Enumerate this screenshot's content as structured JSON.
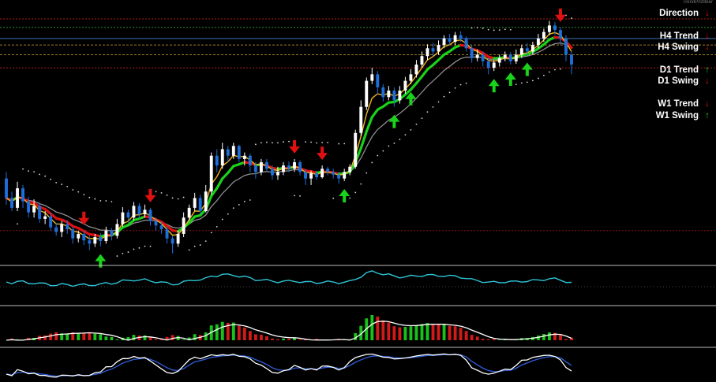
{
  "watermark": "TrendProfiteer",
  "panel": [
    {
      "label": "Direction",
      "direction": "down"
    },
    {
      "label": "H4 Trend",
      "direction": "down"
    },
    {
      "label": "H4 Swing",
      "direction": "down"
    },
    {
      "label": "D1 Trend",
      "direction": "up"
    },
    {
      "label": "D1 Swing",
      "direction": "down"
    },
    {
      "label": "W1 Trend",
      "direction": "down"
    },
    {
      "label": "W1 Swing",
      "direction": "up"
    }
  ],
  "colors": {
    "background": "#000000",
    "candle_up": "#ffffff",
    "candle_down": "#1e6fd9",
    "ema_fast": "#f0b21a",
    "ema_slow_gray": "#8d8d8d",
    "trend_up": "#19d219",
    "trend_down": "#e01010",
    "dots": "#d8d8d8",
    "cyan_line": "#2ec5d6",
    "hist_up": "#19c219",
    "hist_down": "#d21a1a",
    "blue_line": "#2f5fd8",
    "arrow_up": "#19d219",
    "arrow_down": "#e01010",
    "panel_up": "#19d219",
    "panel_down": "#e01010"
  },
  "chart_data": {
    "type": "candlestick",
    "title": "",
    "xlabel": "",
    "ylabel": "",
    "candles": [
      [
        140,
        110,
        150,
        100
      ],
      [
        110,
        95,
        120,
        90
      ],
      [
        95,
        125,
        135,
        90
      ],
      [
        125,
        105,
        130,
        95
      ],
      [
        105,
        88,
        112,
        80
      ],
      [
        88,
        98,
        108,
        80
      ],
      [
        98,
        78,
        104,
        72
      ],
      [
        78,
        82,
        90,
        70
      ],
      [
        82,
        65,
        88,
        60
      ],
      [
        65,
        58,
        72,
        52
      ],
      [
        58,
        70,
        75,
        50
      ],
      [
        70,
        62,
        76,
        55
      ],
      [
        62,
        48,
        66,
        40
      ],
      [
        48,
        55,
        60,
        42
      ],
      [
        55,
        45,
        60,
        38
      ],
      [
        45,
        40,
        52,
        30
      ],
      [
        40,
        50,
        55,
        35
      ],
      [
        50,
        44,
        56,
        36
      ],
      [
        44,
        60,
        66,
        40
      ],
      [
        60,
        52,
        64,
        45
      ],
      [
        52,
        70,
        78,
        48
      ],
      [
        70,
        88,
        96,
        66
      ],
      [
        88,
        80,
        92,
        72
      ],
      [
        80,
        98,
        104,
        76
      ],
      [
        98,
        85,
        102,
        78
      ],
      [
        85,
        92,
        100,
        80
      ],
      [
        92,
        75,
        95,
        68
      ],
      [
        75,
        68,
        80,
        60
      ],
      [
        68,
        62,
        74,
        55
      ],
      [
        62,
        48,
        66,
        40
      ],
      [
        48,
        40,
        52,
        25
      ],
      [
        40,
        55,
        60,
        35
      ],
      [
        55,
        80,
        88,
        50
      ],
      [
        80,
        95,
        100,
        75
      ],
      [
        95,
        110,
        118,
        90
      ],
      [
        110,
        90,
        115,
        85
      ],
      [
        90,
        120,
        130,
        88
      ],
      [
        120,
        175,
        180,
        115
      ],
      [
        175,
        160,
        185,
        150
      ],
      [
        160,
        185,
        195,
        155
      ],
      [
        185,
        175,
        190,
        165
      ],
      [
        175,
        190,
        195,
        170
      ],
      [
        190,
        170,
        192,
        165
      ],
      [
        170,
        175,
        180,
        160
      ],
      [
        175,
        160,
        178,
        150
      ],
      [
        160,
        150,
        165,
        140
      ],
      [
        150,
        165,
        170,
        145
      ],
      [
        165,
        155,
        170,
        150
      ],
      [
        155,
        145,
        160,
        138
      ],
      [
        145,
        150,
        158,
        138
      ],
      [
        150,
        160,
        165,
        145
      ],
      [
        160,
        155,
        166,
        150
      ],
      [
        155,
        165,
        170,
        150
      ],
      [
        165,
        150,
        168,
        145
      ],
      [
        150,
        140,
        155,
        130
      ],
      [
        140,
        148,
        152,
        130
      ],
      [
        148,
        142,
        152,
        138
      ],
      [
        142,
        155,
        160,
        140
      ],
      [
        155,
        150,
        158,
        145
      ],
      [
        150,
        146,
        155,
        140
      ],
      [
        146,
        140,
        150,
        132
      ],
      [
        140,
        150,
        155,
        136
      ],
      [
        150,
        158,
        162,
        145
      ],
      [
        158,
        210,
        215,
        155
      ],
      [
        210,
        250,
        260,
        205
      ],
      [
        250,
        290,
        295,
        245
      ],
      [
        290,
        300,
        310,
        285
      ],
      [
        300,
        280,
        305,
        270
      ],
      [
        280,
        265,
        285,
        258
      ],
      [
        265,
        275,
        282,
        260
      ],
      [
        275,
        260,
        280,
        250
      ],
      [
        260,
        275,
        282,
        255
      ],
      [
        275,
        290,
        296,
        270
      ],
      [
        290,
        300,
        308,
        285
      ],
      [
        300,
        315,
        322,
        295
      ],
      [
        315,
        328,
        335,
        310
      ],
      [
        328,
        340,
        346,
        322
      ],
      [
        340,
        335,
        348,
        328
      ],
      [
        335,
        345,
        352,
        330
      ],
      [
        345,
        355,
        360,
        340
      ],
      [
        355,
        350,
        362,
        345
      ],
      [
        350,
        360,
        365,
        345
      ],
      [
        360,
        355,
        366,
        350
      ],
      [
        355,
        340,
        358,
        335
      ],
      [
        340,
        325,
        345,
        318
      ],
      [
        325,
        330,
        338,
        320
      ],
      [
        330,
        320,
        335,
        312
      ],
      [
        320,
        310,
        325,
        300
      ],
      [
        310,
        318,
        322,
        305
      ],
      [
        318,
        325,
        330,
        312
      ],
      [
        325,
        330,
        335,
        320
      ],
      [
        330,
        320,
        334,
        315
      ],
      [
        320,
        330,
        338,
        316
      ],
      [
        330,
        340,
        345,
        325
      ],
      [
        340,
        335,
        348,
        330
      ],
      [
        335,
        345,
        350,
        330
      ],
      [
        345,
        355,
        362,
        340
      ],
      [
        355,
        365,
        370,
        350
      ],
      [
        365,
        375,
        382,
        360
      ],
      [
        375,
        368,
        380,
        360
      ],
      [
        368,
        355,
        372,
        345
      ],
      [
        355,
        330,
        360,
        320
      ],
      [
        330,
        315,
        335,
        300
      ]
    ]
  }
}
